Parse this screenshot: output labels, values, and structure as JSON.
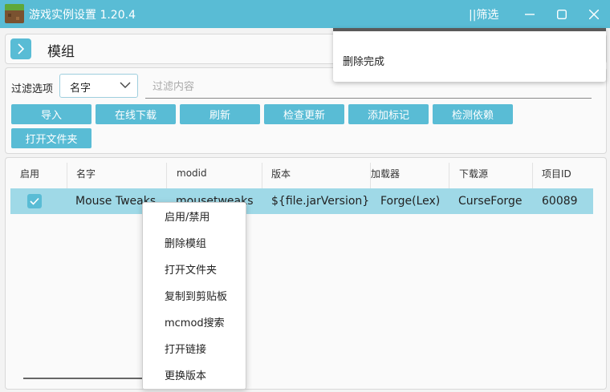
{
  "window": {
    "title": "游戏实例设置 1.20.4",
    "filter_toggle": "||筛选"
  },
  "header": {
    "title": "模组"
  },
  "filter": {
    "label": "过滤选项",
    "selected_option": "名字",
    "input_placeholder": "过滤内容",
    "input_value": ""
  },
  "actions": [
    {
      "label": "导入"
    },
    {
      "label": "在线下载"
    },
    {
      "label": "刷新"
    },
    {
      "label": "检查更新"
    },
    {
      "label": "添加标记"
    },
    {
      "label": "检测依赖"
    },
    {
      "label": "打开文件夹"
    }
  ],
  "table": {
    "columns": [
      "启用",
      "名字",
      "modid",
      "版本",
      "加载器",
      "下载源",
      "项目ID"
    ],
    "rows": [
      {
        "enabled": true,
        "name": "Mouse Tweaks",
        "modid": "mousetweaks",
        "version": "${file.jarVersion}",
        "loader": "Forge(Lex)",
        "source": "CurseForge",
        "project_id": "60089"
      }
    ]
  },
  "toast": {
    "message": "删除完成"
  },
  "context_menu": {
    "items": [
      "启用/禁用",
      "删除模组",
      "打开文件夹",
      "复制到剪贴板",
      "mcmod搜索",
      "打开链接",
      "更换版本"
    ]
  },
  "colors": {
    "accent": "#59bcd5",
    "row_selected": "#9fd9e7",
    "background": "#f3f3f3"
  },
  "icons": {
    "app": "grass-block-icon",
    "expand": "chevron-right-icon",
    "dropdown": "chevron-down-icon",
    "check": "check-icon",
    "minimize": "minimize-icon",
    "maximize": "maximize-icon",
    "close": "close-icon"
  }
}
